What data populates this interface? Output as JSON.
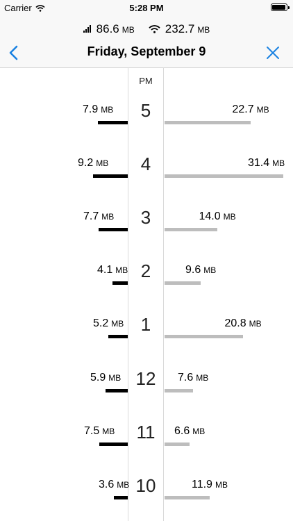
{
  "status_bar": {
    "carrier": "Carrier",
    "time": "5:28 PM",
    "battery_level": 0.95
  },
  "header": {
    "cellular_total": "86.6",
    "cellular_unit": "MB",
    "wifi_total": "232.7",
    "wifi_unit": "MB",
    "title": "Friday, September 9",
    "back_icon": "chevron-left-icon",
    "close_icon": "close-icon",
    "accent_color": "#1a82e2"
  },
  "chart_data": {
    "type": "bar",
    "period_label": "PM",
    "unit": "MB",
    "categories": [
      "5",
      "4",
      "3",
      "2",
      "1",
      "12",
      "11",
      "10"
    ],
    "series": [
      {
        "values": [
          7.9,
          9.2,
          7.7,
          4.1,
          5.2,
          5.9,
          7.5,
          3.6
        ],
        "color": "#000000"
      },
      {
        "values": [
          22.7,
          31.4,
          14.0,
          9.6,
          20.8,
          7.6,
          6.6,
          11.9
        ],
        "color": "#bdbdbd"
      }
    ],
    "rows": [
      {
        "hour": "5",
        "cellular": "7.9",
        "wifi": "22.7"
      },
      {
        "hour": "4",
        "cellular": "9.2",
        "wifi": "31.4"
      },
      {
        "hour": "3",
        "cellular": "7.7",
        "wifi": "14.0"
      },
      {
        "hour": "2",
        "cellular": "4.1",
        "wifi": "9.6"
      },
      {
        "hour": "1",
        "cellular": "5.2",
        "wifi": "20.8"
      },
      {
        "hour": "12",
        "cellular": "5.9",
        "wifi": "7.6"
      },
      {
        "hour": "11",
        "cellular": "7.5",
        "wifi": "6.6"
      },
      {
        "hour": "10",
        "cellular": "3.6",
        "wifi": "11.9"
      }
    ]
  }
}
